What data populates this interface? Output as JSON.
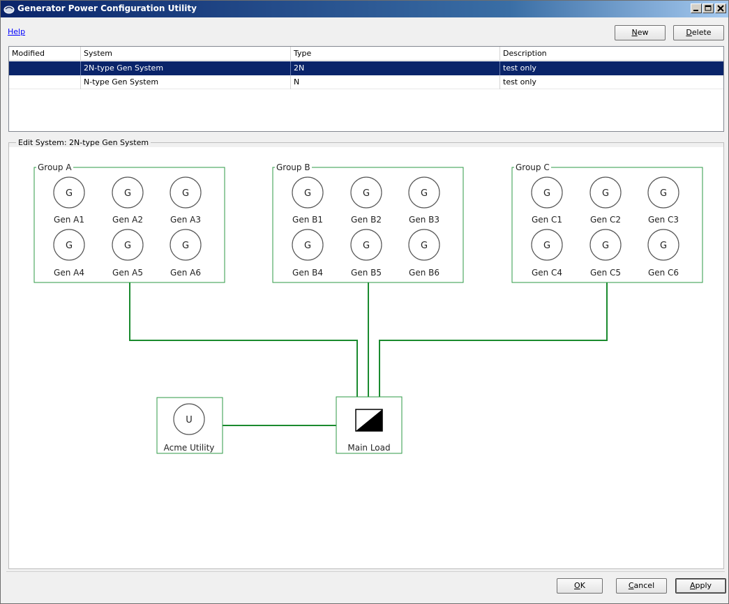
{
  "window": {
    "title": "Generator Power Configuration Utility"
  },
  "toolbar": {
    "help_label": "Help",
    "new_label": "New",
    "new_accel": "N",
    "delete_label": "Delete",
    "delete_accel": "D"
  },
  "table": {
    "columns": [
      "Modified",
      "System",
      "Type",
      "Description"
    ],
    "rows": [
      {
        "modified": "",
        "system": "2N-type Gen System",
        "type": "2N",
        "description": "test only",
        "selected": true
      },
      {
        "modified": "",
        "system": "N-type Gen System",
        "type": "N",
        "description": "test only",
        "selected": false
      }
    ]
  },
  "edit": {
    "legend": "Edit System: 2N-type Gen System"
  },
  "diagram": {
    "groups": [
      {
        "label": "Group A",
        "generators": [
          "Gen A1",
          "Gen A2",
          "Gen A3",
          "Gen A4",
          "Gen A5",
          "Gen A6"
        ]
      },
      {
        "label": "Group B",
        "generators": [
          "Gen B1",
          "Gen B2",
          "Gen B3",
          "Gen B4",
          "Gen B5",
          "Gen B6"
        ]
      },
      {
        "label": "Group C",
        "generators": [
          "Gen C1",
          "Gen C2",
          "Gen C3",
          "Gen C4",
          "Gen C5",
          "Gen C6"
        ]
      }
    ],
    "generator_symbol": "G",
    "utility": {
      "label": "Acme Utility",
      "symbol": "U"
    },
    "load": {
      "label": "Main Load"
    },
    "line_color": "#1a8a2e",
    "box_color": "#2e9a45"
  },
  "footer": {
    "ok_label": "OK",
    "ok_accel": "O",
    "cancel_label": "Cancel",
    "cancel_accel": "C",
    "apply_label": "Apply",
    "apply_accel": "A"
  },
  "colors": {
    "selection": "#0a246a",
    "link": "#0000ff"
  }
}
